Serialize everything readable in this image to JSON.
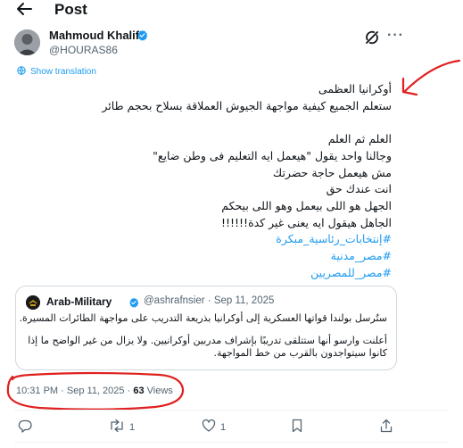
{
  "header": {
    "title": "Post"
  },
  "author": {
    "name": "Mahmoud Khalifa",
    "handle": "@HOURAS86"
  },
  "translate_label": "Show translation",
  "tweet": {
    "lines": [
      "أوكرانيا العظمى",
      "ستعلم الجميع كيفية مواجهة الجيوش العملاقة بسلاح بحجم طائر",
      "العلم ثم العلم",
      "وجالنا واحد يقول \"هيعمل ايه التعليم فى وطن ضايع\"",
      "مش هيعمل حاجة حضرتك",
      "انت عندك حق",
      "الجهل هو اللى بيعمل وهو اللى بيحكم",
      "الجاهل هيقول ايه يعنى غير كدة!!!!!!"
    ],
    "hashtags": [
      "#إنتخابات_رئاسية_مبكرة",
      "#مصر_مدنية",
      "#مصر_للمصريين"
    ]
  },
  "quote": {
    "name": "Arab-Military",
    "handle": "@ashrafnsier",
    "date": "Sep 11, 2025",
    "separator": "·",
    "lines": [
      "ستُرسل بولندا قواتها العسكرية إلى أوكرانيا بذريعة التدريب على مواجهة الطائرات المسيرة.",
      "أعلنت وارسو أنها ستتلقى تدريبًا بإشراف مدربين أوكرانيين. ولا يزال من غير الواضح ما إذا",
      "كانوا سيتواجدون بالقرب من خط المواجهة."
    ]
  },
  "meta": {
    "time": "10:31 PM",
    "date": "Sep 11, 2025",
    "separator": "·",
    "views_count": "63",
    "views_label": "Views"
  },
  "actions": {
    "reposts": "1",
    "likes": "1"
  },
  "colors": {
    "accent": "#1d9bf0",
    "text": "#0f1419",
    "secondary": "#536471",
    "annotation": "#e02020"
  }
}
